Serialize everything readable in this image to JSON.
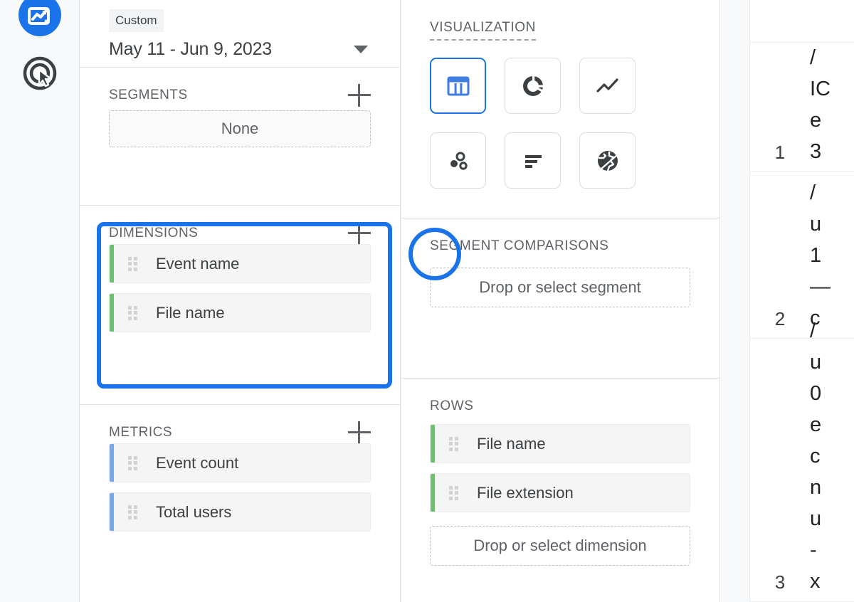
{
  "app": {
    "name": "Google Analytics Explore",
    "accent_blue": "#1a73e8",
    "dimension_green": "#6fbf73",
    "metric_blue": "#7aa7e8"
  },
  "rail": {
    "items": [
      {
        "icon": "analytics-explore-icon",
        "label": "Explore"
      },
      {
        "icon": "advertising-target-icon",
        "label": "Advertising"
      }
    ]
  },
  "variables_panel": {
    "date_range": {
      "chip": "Custom",
      "value": "May 11 - Jun 9, 2023",
      "caret": "chevron-down-icon"
    },
    "segments": {
      "title": "SEGMENTS",
      "add_label": "+",
      "empty_label": "None"
    },
    "dimensions": {
      "title": "DIMENSIONS",
      "add_label": "+",
      "items": [
        {
          "label": "Event name"
        },
        {
          "label": "File name"
        }
      ]
    },
    "metrics": {
      "title": "METRICS",
      "add_label": "+",
      "items": [
        {
          "label": "Event count"
        },
        {
          "label": "Total users"
        }
      ]
    }
  },
  "tab_settings_panel": {
    "visualization": {
      "title": "VISUALIZATION",
      "options": [
        {
          "icon": "table-chart-icon",
          "label": "Free form table",
          "selected": true
        },
        {
          "icon": "donut-chart-icon",
          "label": "Donut chart",
          "selected": false
        },
        {
          "icon": "line-chart-icon",
          "label": "Line chart",
          "selected": false
        },
        {
          "icon": "scatter-plot-icon",
          "label": "Scatter plot",
          "selected": false
        },
        {
          "icon": "bar-chart-icon",
          "label": "Bar chart",
          "selected": false
        },
        {
          "icon": "geo-map-icon",
          "label": "Geo map",
          "selected": false
        }
      ]
    },
    "segment_comparisons": {
      "title": "SEGMENT COMPARISONS",
      "drop_label": "Drop or select segment"
    },
    "rows": {
      "title": "ROWS",
      "items": [
        {
          "label": "File name"
        },
        {
          "label": "File extension"
        }
      ],
      "drop_label": "Drop or select dimension"
    }
  },
  "results_table": {
    "rows": [
      {
        "index": "1",
        "lines": [
          "/",
          "IC",
          "e",
          "3"
        ]
      },
      {
        "index": "2",
        "lines": [
          "/",
          "u",
          "1",
          "—",
          "c"
        ]
      },
      {
        "index": "3",
        "lines": [
          "/",
          "u",
          "0",
          "e",
          "c",
          "n",
          "u",
          "-",
          "x"
        ]
      }
    ]
  }
}
